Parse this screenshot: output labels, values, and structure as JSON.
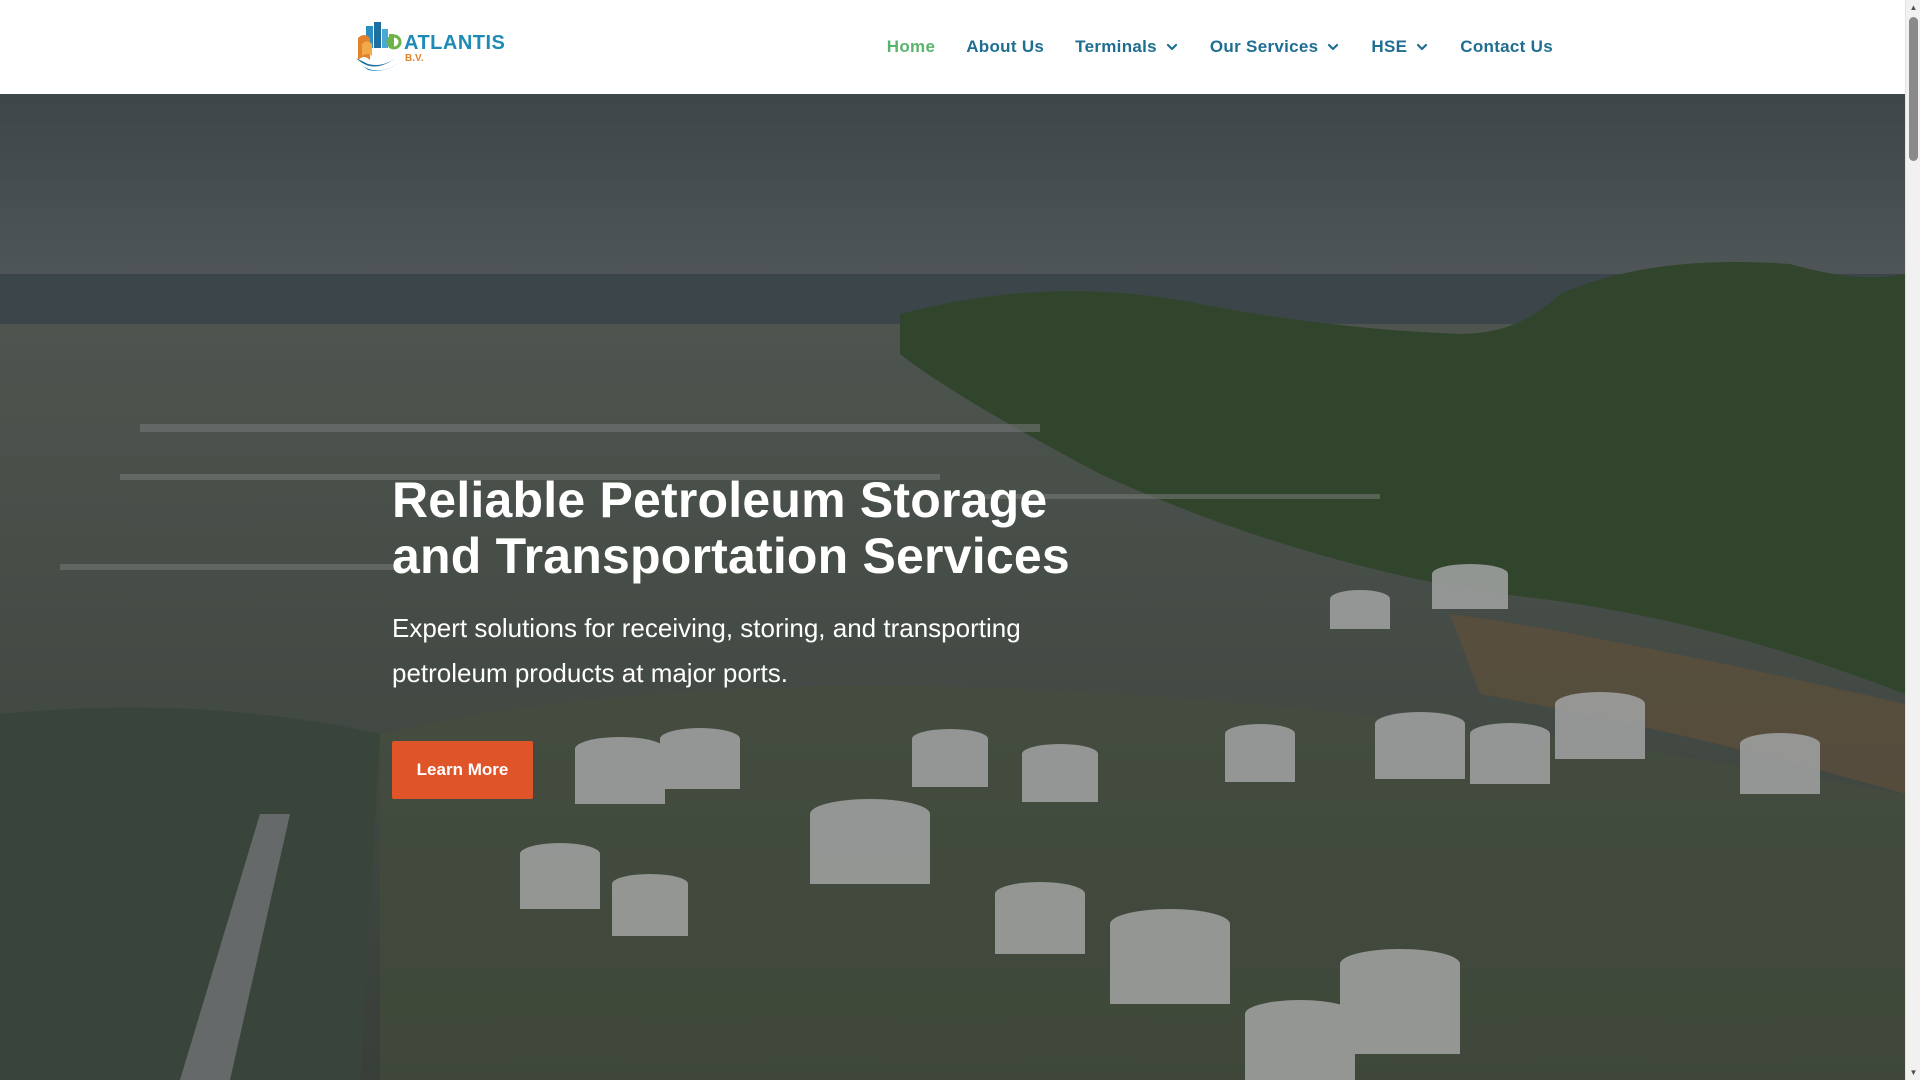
{
  "header": {
    "logo": {
      "wordmark": "ATLANTIS",
      "subline": "B.V."
    },
    "nav": [
      {
        "label": "Home",
        "active": true,
        "has_dropdown": false
      },
      {
        "label": "About Us",
        "active": false,
        "has_dropdown": false
      },
      {
        "label": "Terminals",
        "active": false,
        "has_dropdown": true
      },
      {
        "label": "Our Services",
        "active": false,
        "has_dropdown": true
      },
      {
        "label": "HSE",
        "active": false,
        "has_dropdown": true
      },
      {
        "label": "Contact Us",
        "active": false,
        "has_dropdown": false
      }
    ]
  },
  "hero": {
    "title_line1": "Reliable Petroleum Storage",
    "title_line2": "and Transportation Services",
    "subtitle": "Expert solutions for receiving, storing, and transporting petroleum products at major ports.",
    "cta_label": "Learn More",
    "background": "aerial photo of an oil refinery and tank farm near a harbor with green hills"
  },
  "icons": {
    "nav_dropdown": "chevron-down-icon",
    "scroll_up": "arrow-up-icon",
    "scroll_down": "arrow-down-icon"
  },
  "colors": {
    "nav_text": "#1f6e92",
    "nav_active": "#59b36d",
    "cta_background": "#e0542a",
    "logo_primary": "#1e8bb7",
    "logo_accent": "#e2832c"
  }
}
